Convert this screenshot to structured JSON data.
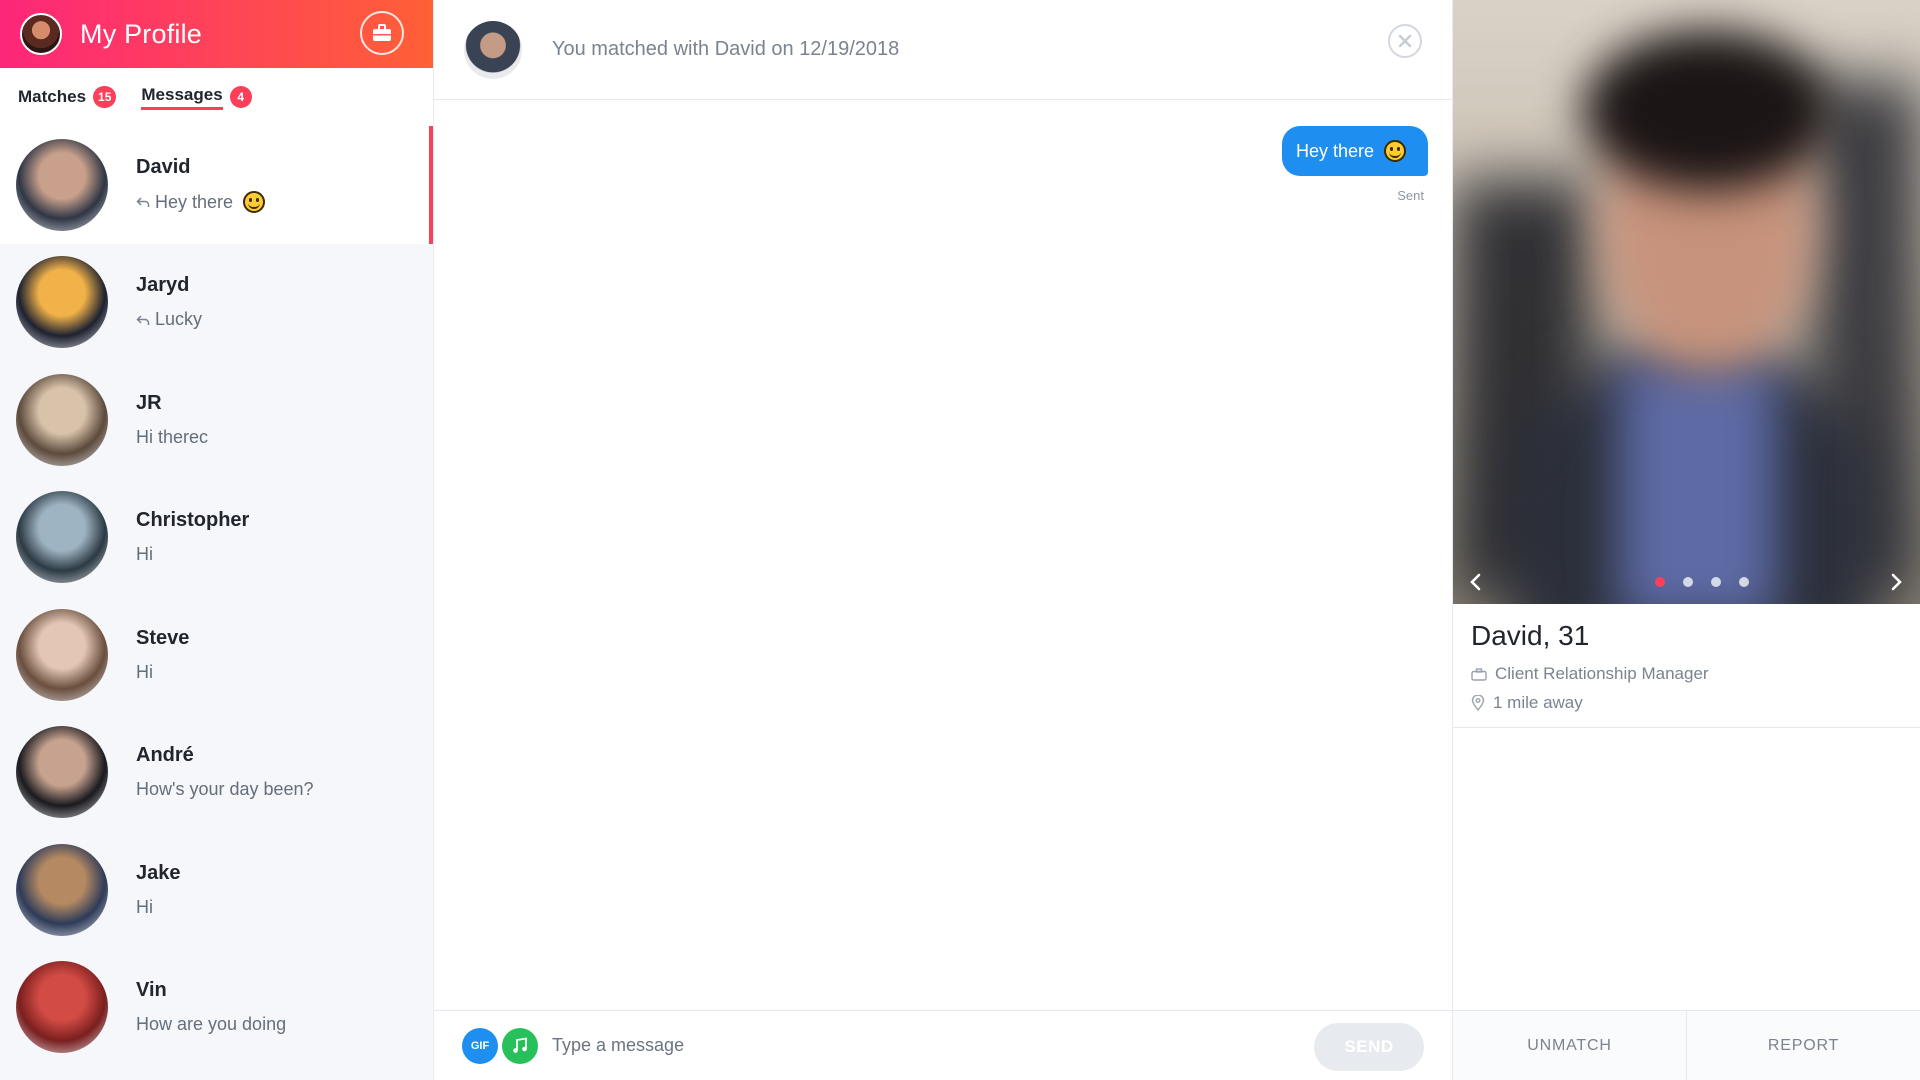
{
  "header": {
    "title": "My Profile"
  },
  "tabs": [
    {
      "label": "Matches",
      "count": "15"
    },
    {
      "label": "Messages",
      "count": "4"
    }
  ],
  "conversations": [
    {
      "name": "David",
      "message": "Hey there",
      "replied": true,
      "emoji": true,
      "active": true,
      "avatar_colors": [
        "#c8a08b",
        "#2f3645"
      ]
    },
    {
      "name": "Jaryd",
      "message": "Lucky",
      "replied": true,
      "emoji": false,
      "active": false,
      "avatar_colors": [
        "#f2b24a",
        "#1e2230"
      ]
    },
    {
      "name": "JR",
      "message": "Hi therec",
      "replied": false,
      "emoji": false,
      "active": false,
      "avatar_colors": [
        "#d9c2aa",
        "#5c4a3c"
      ]
    },
    {
      "name": "Christopher",
      "message": "Hi",
      "replied": false,
      "emoji": false,
      "active": false,
      "avatar_colors": [
        "#9fb4c2",
        "#2c3a44"
      ]
    },
    {
      "name": "Steve",
      "message": "Hi",
      "replied": false,
      "emoji": false,
      "active": false,
      "avatar_colors": [
        "#e3c7b4",
        "#6a4e3e"
      ]
    },
    {
      "name": "André",
      "message": "How's your day been?",
      "replied": false,
      "emoji": false,
      "active": false,
      "avatar_colors": [
        "#c7a38f",
        "#1a1a1f"
      ]
    },
    {
      "name": "Jake",
      "message": "Hi",
      "replied": false,
      "emoji": false,
      "active": false,
      "avatar_colors": [
        "#b58a63",
        "#2e3b59"
      ]
    },
    {
      "name": "Vin",
      "message": "How are you doing",
      "replied": false,
      "emoji": false,
      "active": false,
      "avatar_colors": [
        "#d24b44",
        "#7a1f1f"
      ]
    }
  ],
  "chat": {
    "match_text": "You matched with David on 12/19/2018",
    "messages": [
      {
        "text": "Hey there",
        "emoji": true,
        "status": "Sent"
      }
    ],
    "composer": {
      "gif_label": "GIF",
      "placeholder": "Type a message",
      "send_label": "SEND"
    }
  },
  "profile": {
    "name_age": "David, 31",
    "job": "Client Relationship Manager",
    "distance": "1 mile away",
    "photo_count": 4,
    "photo_active_index": 0,
    "unmatch_label": "UNMATCH",
    "report_label": "REPORT"
  },
  "colors": {
    "brand_start": "#fd267a",
    "brand_end": "#ff6036",
    "accent": "#fd3f5a",
    "bubble": "#1f8ef1",
    "music": "#27c05a"
  }
}
